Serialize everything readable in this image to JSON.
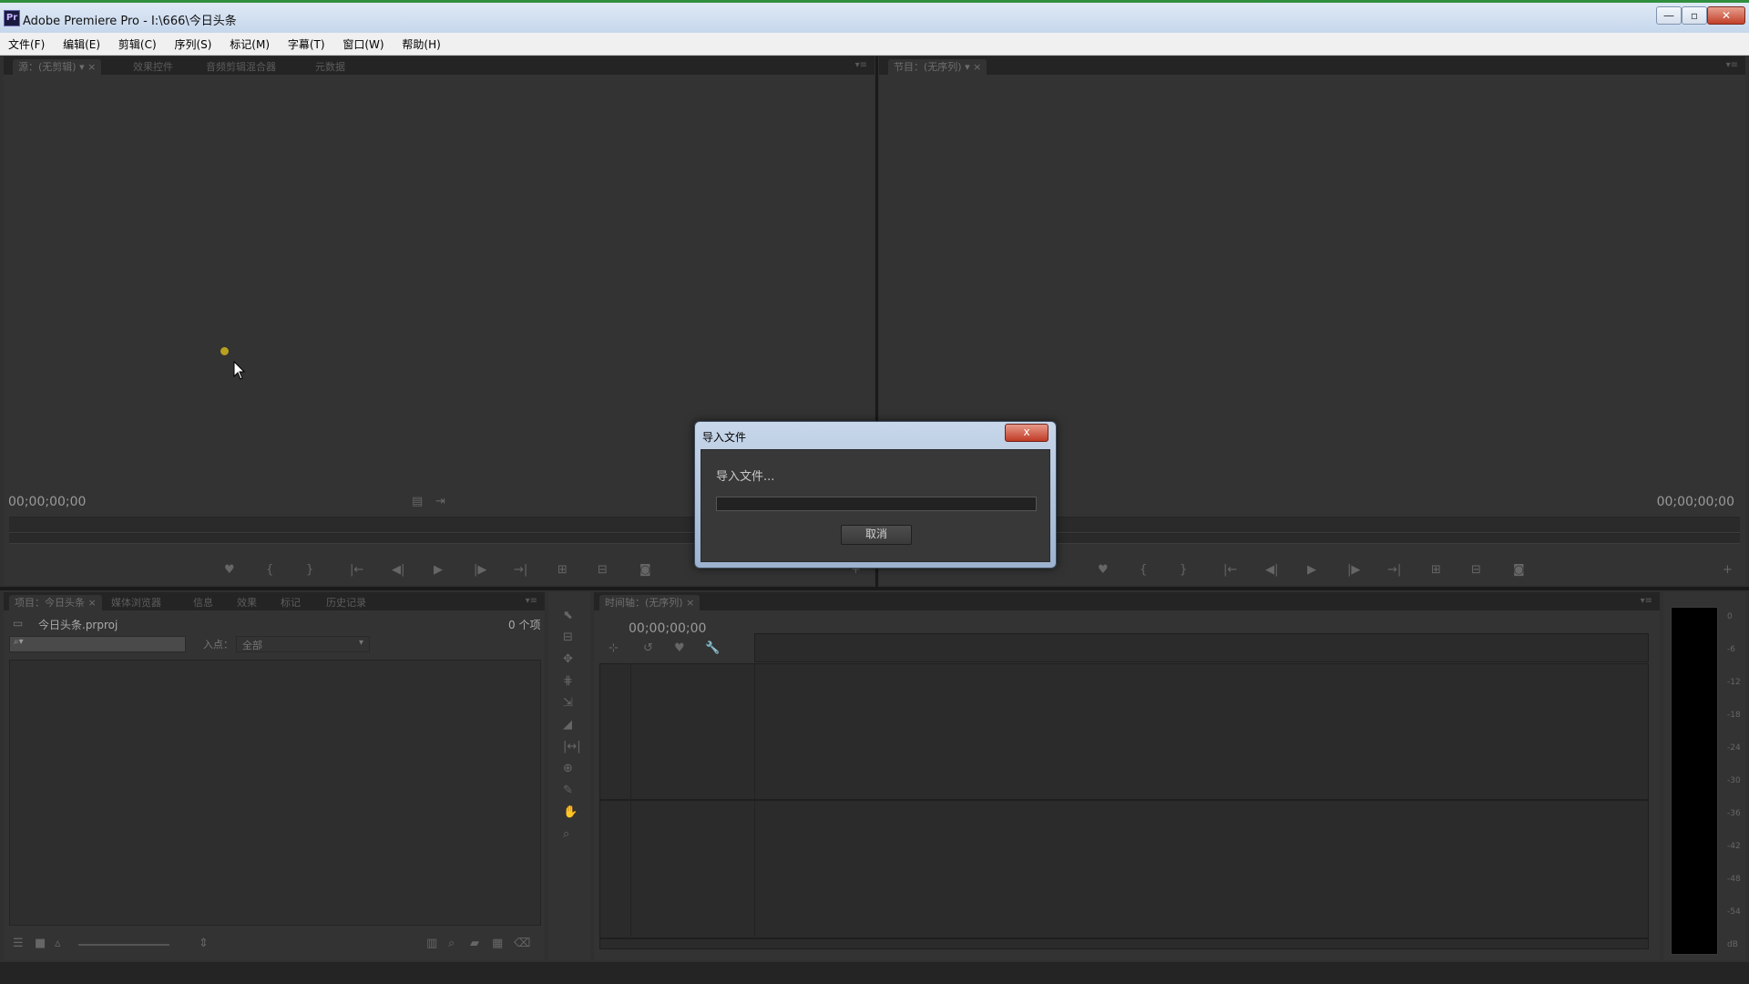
{
  "window": {
    "app_icon": "Pr",
    "title": "Adobe Premiere Pro - I:\\666\\今日头条",
    "controls": {
      "minimize": "—",
      "maximize": "▫",
      "close": "✕"
    }
  },
  "menu": [
    "文件(F)",
    "编辑(E)",
    "剪辑(C)",
    "序列(S)",
    "标记(M)",
    "字幕(T)",
    "窗口(W)",
    "帮助(H)"
  ],
  "source_monitor": {
    "tabs": [
      "源：(无剪辑)",
      "效果控件",
      "音频剪辑混合器",
      "元数据"
    ],
    "timecode": "00;00;00;00"
  },
  "program_monitor": {
    "tabs": [
      "节目：(无序列)"
    ],
    "timecode": "00;00;00;00"
  },
  "project_panel": {
    "tabs": [
      "项目：今日头条",
      "媒体浏览器",
      "信息",
      "效果",
      "标记",
      "历史记录"
    ],
    "project_file": "今日头条.prproj",
    "item_count": "0 个项",
    "in_point_label": "入点：",
    "in_point_value": "全部"
  },
  "timeline": {
    "tabs": [
      "时间轴：(无序列)"
    ],
    "timecode": "00;00;00;00"
  },
  "audio_meter": {
    "labels": [
      "0",
      "-6",
      "-12",
      "-18",
      "-24",
      "-30",
      "-36",
      "-42",
      "-48",
      "-54",
      "dB"
    ]
  },
  "dialog": {
    "title": "导入文件",
    "close_label": "x",
    "message": "导入文件...",
    "progress": 0,
    "cancel_label": "取消"
  },
  "colors": {
    "panel_bg": "#333333",
    "dialog_frame": "#9cb2cf",
    "cursor_dot": "#b8a020"
  }
}
